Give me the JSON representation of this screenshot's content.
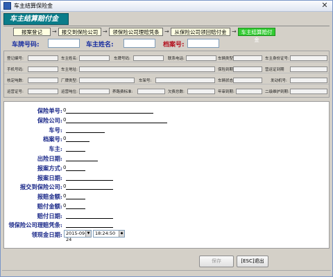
{
  "window": {
    "title": "车主结算保险金",
    "close_glyph": "✕"
  },
  "header": {
    "label": "车主结算赔付金"
  },
  "steps": [
    "报案登记",
    "报交到保险公司",
    "领保险公司理赔凭条",
    "从保险公司领回赔付金",
    "车主结算赔付金"
  ],
  "step_arrow": "→",
  "top_fields": {
    "plate_label": "车牌号码:",
    "owner_label": "车主姓名:",
    "file_label": "档案号:"
  },
  "info_labels": {
    "row1": [
      "登记编号:",
      "车主姓名:",
      "车牌号码:",
      "联系电话:",
      "车辆类型",
      "车主身份证号:"
    ],
    "row2": [
      "手机号码:",
      "车主地址:",
      "保险到期:",
      "营运证到期"
    ],
    "row3": [
      "核定吨数:",
      "厂牌类型:",
      "车架号:",
      "车辆状态:",
      "发动机号:"
    ],
    "row4": [
      "运营证号:",
      "运营吨位:",
      "养路费标准:",
      "欠费总数:",
      "年审到期:",
      "二级维护到期:"
    ]
  },
  "form": {
    "labels": [
      "保险单号:",
      "保险公司:",
      "车号:",
      "档案号:",
      "车主:",
      "出险日期:",
      "报案方式:",
      "报案日期:",
      "报交到保险公司:",
      "报赔金额:",
      "赔付金额:",
      "赔付日期:",
      "领保险公司理赔凭条:",
      "领现金日期:"
    ],
    "values": [
      "0",
      "0",
      "",
      "0",
      "",
      "",
      "0",
      "",
      "0",
      "0",
      "0",
      "",
      "",
      ""
    ],
    "cash_date": "2015-09-24",
    "cash_time": "18:24:50"
  },
  "buttons": {
    "save": "保存",
    "exit": "[ESC]退出"
  },
  "colors": {
    "active_step": "#33cc33",
    "header_bg": "#0a7d8a",
    "label_blue": "#1c2a8a"
  }
}
